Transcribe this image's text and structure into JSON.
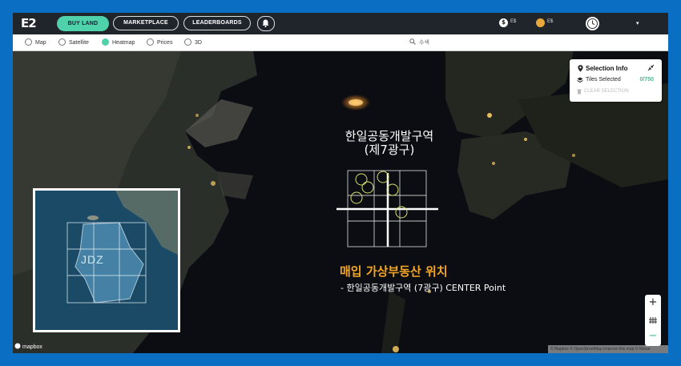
{
  "topbar": {
    "logo": "E2",
    "buy_land": "BUY LAND",
    "marketplace": "MARKETPLACE",
    "leaderboards": "LEADERBOARDS",
    "balance1_symbol": "$",
    "balance1_label": "E$",
    "balance2_label": "E$",
    "caret": "▾"
  },
  "filters": {
    "items": [
      {
        "label": "Map",
        "active": false
      },
      {
        "label": "Satellite",
        "active": false
      },
      {
        "label": "Heatmap",
        "active": true
      },
      {
        "label": "Prices",
        "active": false
      },
      {
        "label": "3D",
        "active": false
      }
    ],
    "search_placeholder": "수색"
  },
  "selection": {
    "title": "Selection Info",
    "tiles_label": "Tiles Selected",
    "tiles_count": "0/750",
    "clear_label": "CLEAR SELECTION"
  },
  "map": {
    "title_line1": "한일공동개발구역",
    "title_line2": "(제7광구)",
    "highlight": "매입 가상부동산 위치",
    "detail": "- 한일공동개발구역 (7광구) CENTER Point",
    "inset_label": "JDZ",
    "mapbox": "mapbox",
    "attribution": "© Mapbox © OpenStreetMap Improve this map © Maxar"
  },
  "zoom": {
    "plus": "+",
    "minus": "−"
  },
  "colors": {
    "accent": "#4fd1a9",
    "highlight": "#f5a623",
    "frame": "#0a6fc2"
  }
}
